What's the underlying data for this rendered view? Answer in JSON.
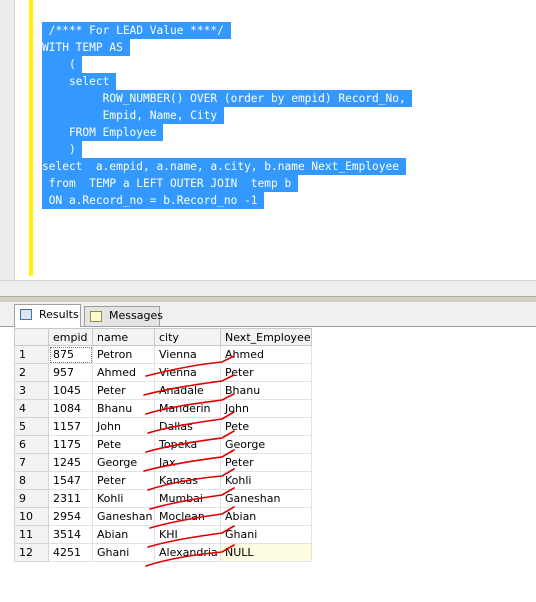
{
  "editor": {
    "lines": [
      " /**** For LEAD Value ****/ ",
      "WITH TEMP AS ",
      "    ( ",
      "    select ",
      "         ROW_NUMBER() OVER (order by empid) Record_No, ",
      "         Empid, Name, City ",
      "    FROM Employee ",
      "    ) ",
      "select  a.empid, a.name, a.city, b.name Next_Employee ",
      " from  TEMP a LEFT OUTER JOIN  temp b ",
      " ON a.Record_no = b.Record_no -1 "
    ]
  },
  "tabs": {
    "results_label": "Results",
    "messages_label": "Messages"
  },
  "grid": {
    "columns": [
      "",
      "empid",
      "name",
      "city",
      "Next_Employee"
    ],
    "rows": [
      [
        "1",
        "875",
        "Petron",
        "Vienna",
        "Ahmed"
      ],
      [
        "2",
        "957",
        "Ahmed",
        "Vienna",
        "Peter"
      ],
      [
        "3",
        "1045",
        "Peter",
        "Anadale",
        "Bhanu"
      ],
      [
        "4",
        "1084",
        "Bhanu",
        "Manderin",
        "John"
      ],
      [
        "5",
        "1157",
        "John",
        "Dallas",
        "Pete"
      ],
      [
        "6",
        "1175",
        "Pete",
        "Topeka",
        "George"
      ],
      [
        "7",
        "1245",
        "George",
        "Jax",
        "Peter"
      ],
      [
        "8",
        "1547",
        "Peter",
        "Kansas",
        "Kohli"
      ],
      [
        "9",
        "2311",
        "Kohli",
        "Mumbai",
        "Ganeshan"
      ],
      [
        "10",
        "2954",
        "Ganeshan",
        "Moclean",
        "Abian"
      ],
      [
        "11",
        "3514",
        "Abian",
        "KHI",
        "Ghani"
      ],
      [
        "12",
        "4251",
        "Ghani",
        "Alexandria",
        "NULL"
      ]
    ]
  },
  "colors": {
    "selection": "#3399ff",
    "change_bar": "#fff200",
    "annotation": "#e00000",
    "null_cell": "#fffde1"
  }
}
